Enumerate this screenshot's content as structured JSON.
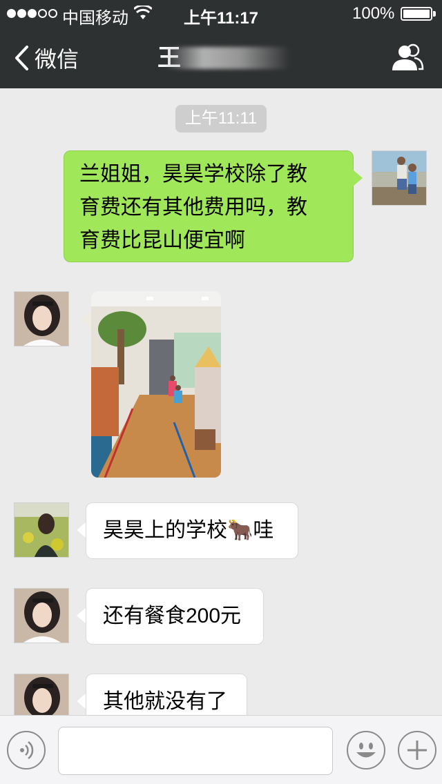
{
  "status": {
    "carrier": "中国移动",
    "time": "上午11:17",
    "battery": "100%",
    "battery_level": 1.0,
    "signal_bars_filled": 3,
    "signal_bars_total": 5
  },
  "nav": {
    "back_label": "微信",
    "title": "王",
    "title_obscured": true
  },
  "chat": {
    "timestamp": "上午11:11",
    "messages": [
      {
        "sender": "me",
        "type": "text",
        "lines": [
          "兰姐姐，昊昊学校除了教",
          "育费还有其他费用吗，教",
          "育费比昆山便宜啊"
        ]
      },
      {
        "sender": "contact",
        "type": "image"
      },
      {
        "sender": "contact2",
        "type": "text",
        "text": "昊昊上的学校🐂哇"
      },
      {
        "sender": "contact",
        "type": "text",
        "text": "还有餐食200元"
      },
      {
        "sender": "contact",
        "type": "text",
        "text": "其他就没有了"
      }
    ]
  },
  "input": {
    "value": "",
    "placeholder": ""
  },
  "colors": {
    "header_bg": "#2e3132",
    "chat_bg": "#ebebeb",
    "my_bubble": "#a0e75a",
    "their_bubble": "#ffffff",
    "timestamp_bg": "#cecece"
  },
  "icons": {
    "back": "chevron-left-icon",
    "contacts": "contacts-icon",
    "voice": "voice-icon",
    "emoji": "smiley-icon",
    "plus": "plus-icon",
    "wifi": "wifi-icon",
    "battery": "battery-icon"
  }
}
